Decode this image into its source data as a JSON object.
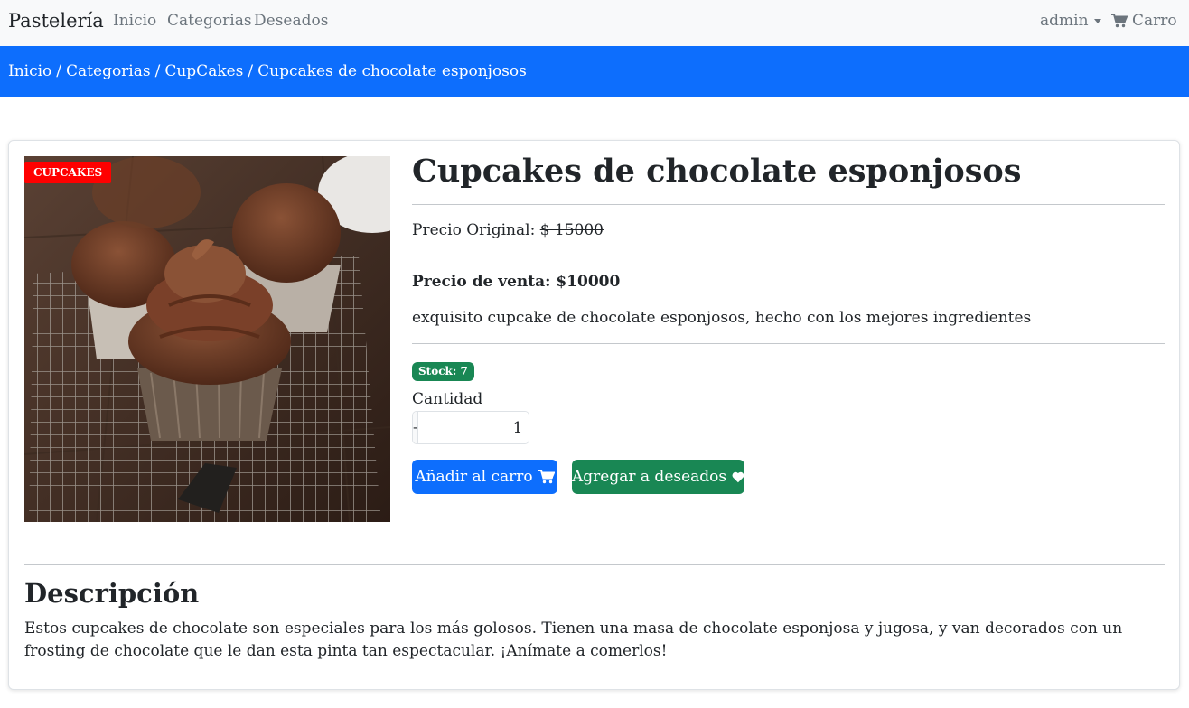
{
  "navbar": {
    "brand": "Pastelería",
    "links": [
      "Inicio",
      "Categorias",
      "Deseados"
    ],
    "user": "admin",
    "cart": "Carro"
  },
  "breadcrumb": [
    "Inicio",
    "Categorias",
    "CupCakes",
    "Cupcakes de chocolate esponjosos"
  ],
  "product": {
    "category_badge": "CUPCAKES",
    "title": "Cupcakes de chocolate esponjosos",
    "original_price_label": "Precio Original:",
    "original_price": "$ 15000",
    "sale_price": "Precio de venta: $10000",
    "short_description": "exquisito cupcake de chocolate esponjosos, hecho con los mejores ingredientes",
    "stock": "Stock: 7",
    "quantity_label": "Cantidad",
    "quantity_value": "1",
    "minus": "-",
    "plus": "+",
    "add_to_cart": "Añadir al carro",
    "add_to_wishlist": "Agregar a deseados"
  },
  "description": {
    "title": "Descripción",
    "body": "Estos cupcakes de chocolate son especiales para los más golosos. Tienen una masa de chocolate esponjosa y jugosa, y van decorados con un frosting de chocolate que le dan esta pinta tan espectacular. ¡Anímate a comerlos!"
  },
  "colors": {
    "primary": "#0d6efd",
    "success": "#198754",
    "danger": "#ff0000",
    "navbar_bg": "#f8f9fa"
  }
}
